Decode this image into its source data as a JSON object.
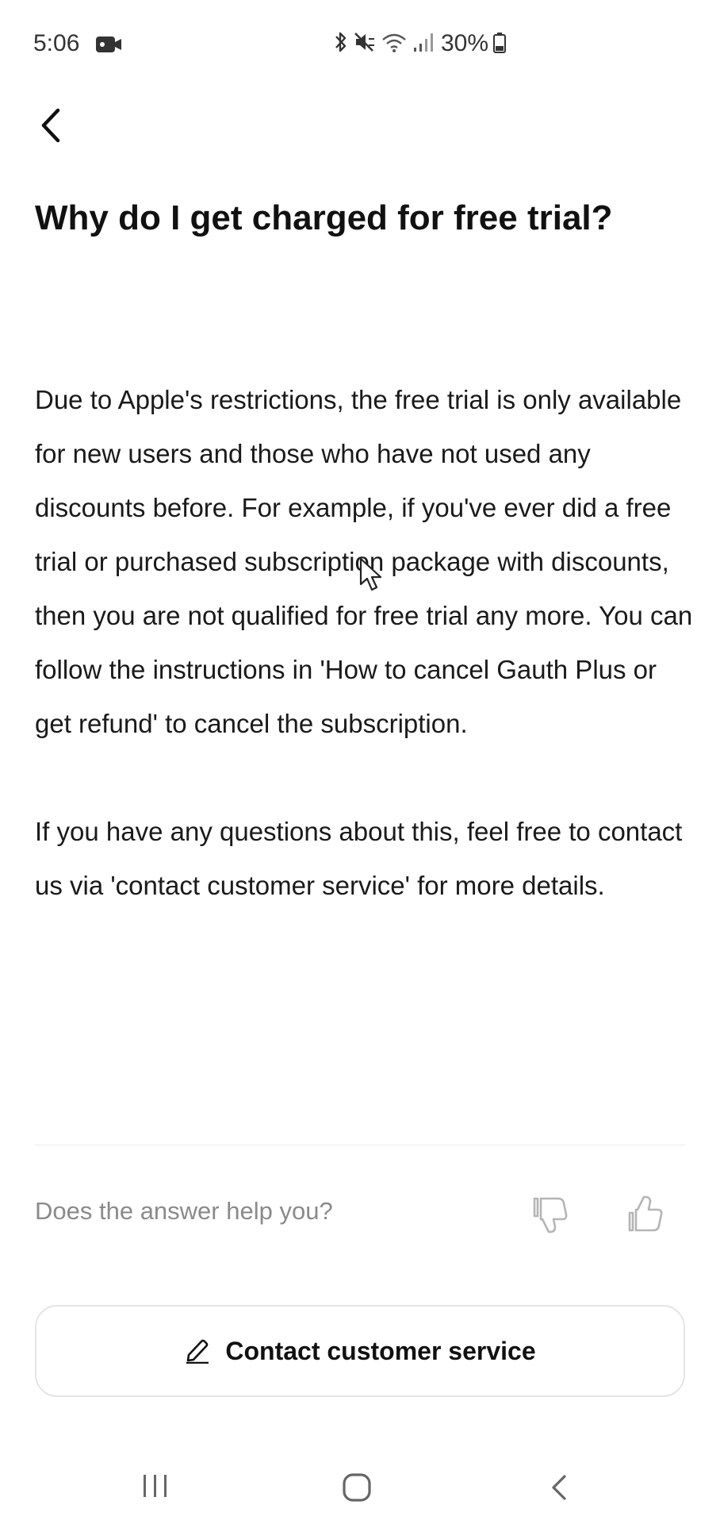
{
  "status_bar": {
    "time": "5:06",
    "battery": "30%",
    "icons": [
      "video-camera-icon",
      "bluetooth-icon",
      "mute-icon",
      "wifi-icon",
      "signal-icon",
      "battery-icon"
    ]
  },
  "header": {
    "back_icon": "back-arrow-icon"
  },
  "article": {
    "title": "Why do I get charged for free trial?",
    "paragraphs": [
      "Due to Apple's restrictions, the free trial is only available for new users and those who have not used any discounts before. For example, if you've ever did a free trial or purchased subscription package with discounts, then you are not qualified for free trial any more. You can follow the instructions in 'How to cancel Gauth Plus or get refund' to cancel the subscription.",
      "If you have any questions about this, feel free to contact us via 'contact customer service' for more details."
    ]
  },
  "feedback": {
    "question": "Does the answer help you?",
    "icons": [
      "thumbs-down-icon",
      "thumbs-up-icon"
    ]
  },
  "contact_button": {
    "label": "Contact customer service",
    "icon": "edit-pencil-icon"
  },
  "nav_bar": {
    "icons": [
      "recent-apps-icon",
      "home-icon",
      "back-icon"
    ]
  }
}
